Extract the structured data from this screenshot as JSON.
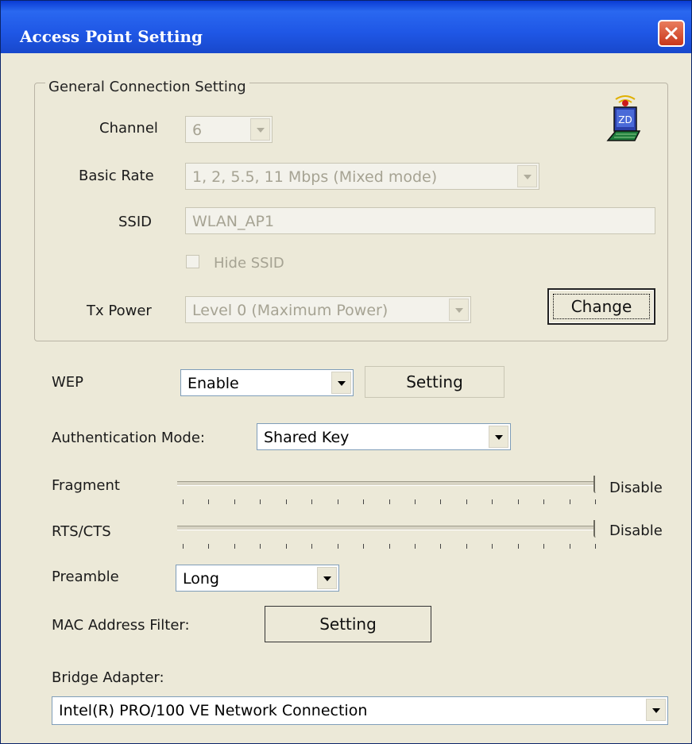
{
  "window": {
    "title": "Access Point Setting"
  },
  "general": {
    "group_title": "General Connection Setting",
    "channel": {
      "label": "Channel",
      "value": "6"
    },
    "basic_rate": {
      "label": "Basic Rate",
      "value": "1, 2, 5.5, 11 Mbps (Mixed mode)"
    },
    "ssid": {
      "label": "SSID",
      "value": "WLAN_AP1"
    },
    "hide_ssid": {
      "label": "Hide SSID",
      "checked": false
    },
    "tx_power": {
      "label": "Tx Power",
      "value": "Level 0 (Maximum Power)"
    },
    "change_button": "Change"
  },
  "wep": {
    "label": "WEP",
    "value": "Enable",
    "setting_button": "Setting"
  },
  "auth": {
    "label": "Authentication Mode:",
    "value": "Shared Key"
  },
  "fragment": {
    "label": "Fragment",
    "value_text": "Disable"
  },
  "rts_cts": {
    "label": "RTS/CTS",
    "value_text": "Disable"
  },
  "preamble": {
    "label": "Preamble",
    "value": "Long"
  },
  "mac_filter": {
    "label": "MAC Address Filter:",
    "setting_button": "Setting"
  },
  "bridge": {
    "label": "Bridge Adapter:",
    "value": "Intel(R) PRO/100 VE Network Connection"
  },
  "icons": {
    "close": "close-icon",
    "app": "zd-wireless-icon"
  },
  "colors": {
    "titlebar": "#1f57e6",
    "face": "#ece9d8",
    "close": "#c8371a"
  }
}
